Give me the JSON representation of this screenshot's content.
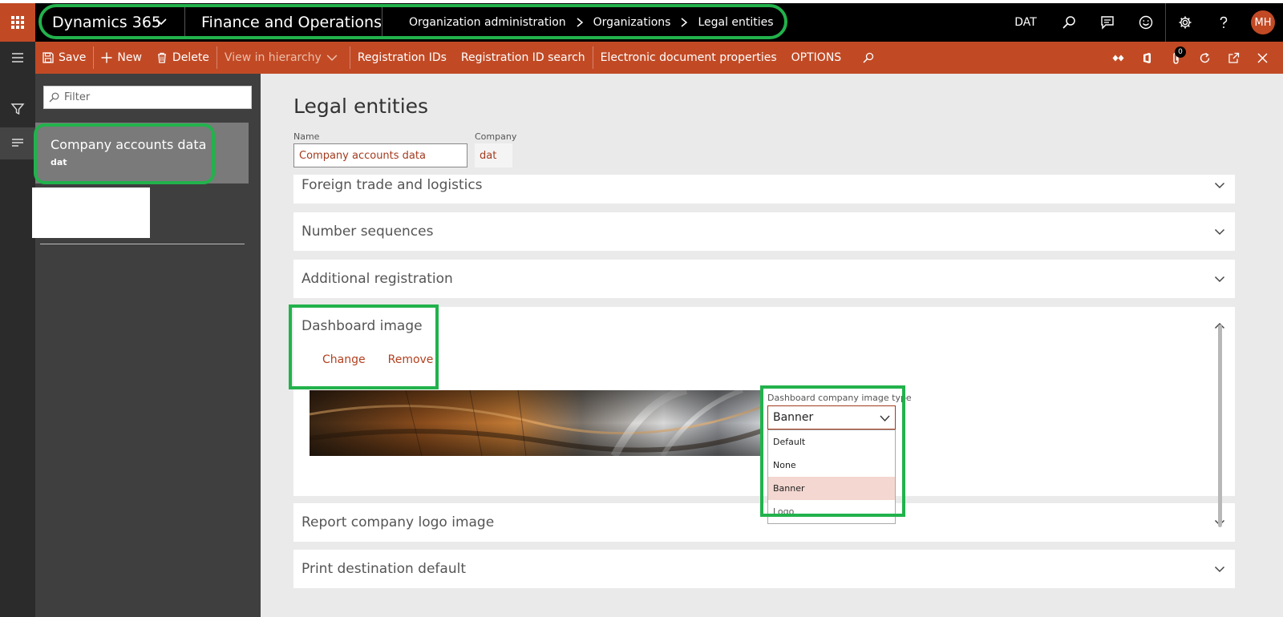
{
  "nav": {
    "product": "Dynamics 365",
    "app": "Finance and Operations",
    "breadcrumb": [
      "Organization administration",
      "Organizations",
      "Legal entities"
    ],
    "company": "DAT",
    "user_initials": "MH"
  },
  "actions": {
    "save": "Save",
    "new": "New",
    "delete": "Delete",
    "view_hierarchy": "View in hierarchy",
    "registration_ids": "Registration IDs",
    "registration_id_search": "Registration ID search",
    "electronic_document_properties": "Electronic document properties",
    "options": "OPTIONS",
    "notification_count": "0"
  },
  "list": {
    "filter_placeholder": "Filter",
    "items": [
      {
        "title": "Company accounts data",
        "subtitle": "dat"
      }
    ]
  },
  "form": {
    "title": "Legal entities",
    "name_label": "Name",
    "name_value": "Company accounts data",
    "company_label": "Company",
    "company_value": "dat"
  },
  "fasttabs": {
    "foreign_trade": "Foreign trade and logistics",
    "number_sequences": "Number sequences",
    "additional_registration": "Additional registration",
    "dashboard_image": "Dashboard image",
    "report_logo": "Report company logo image",
    "print_destination": "Print destination default"
  },
  "dashboard": {
    "change": "Change",
    "remove": "Remove",
    "image_type_label": "Dashboard company image type",
    "image_type_value": "Banner",
    "options": [
      "Default",
      "None",
      "Banner",
      "Logo"
    ]
  },
  "colors": {
    "accent": "#c14a25",
    "highlight": "#22b24c"
  }
}
